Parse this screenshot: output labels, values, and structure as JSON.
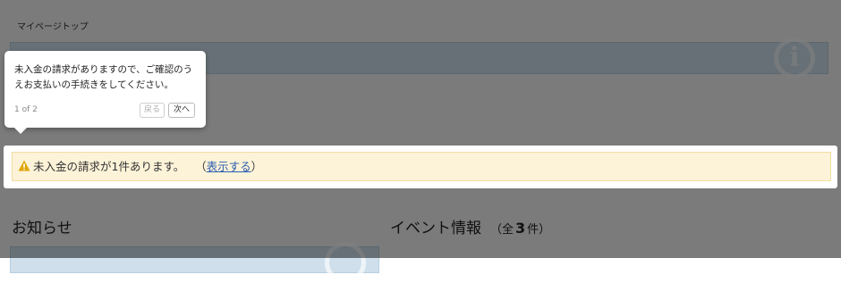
{
  "breadcrumb": {
    "label": "マイページトップ"
  },
  "alert": {
    "text": "未入金の請求が1件あります。",
    "link_open": "（",
    "link_label": "表示する",
    "link_close": "）",
    "icon": "warning-icon",
    "icon_color": "#e0a500"
  },
  "sections": {
    "news": {
      "title": "お知らせ"
    },
    "events": {
      "title": "イベント情報",
      "count_prefix": "（全",
      "count": "3",
      "count_suffix": "件）"
    }
  },
  "tour": {
    "message": "未入金の請求がありますので、ご確認のうえお支払いの手続きをしてください。",
    "step": "1 of 2",
    "back_label": "戻る",
    "next_label": "次へ"
  }
}
